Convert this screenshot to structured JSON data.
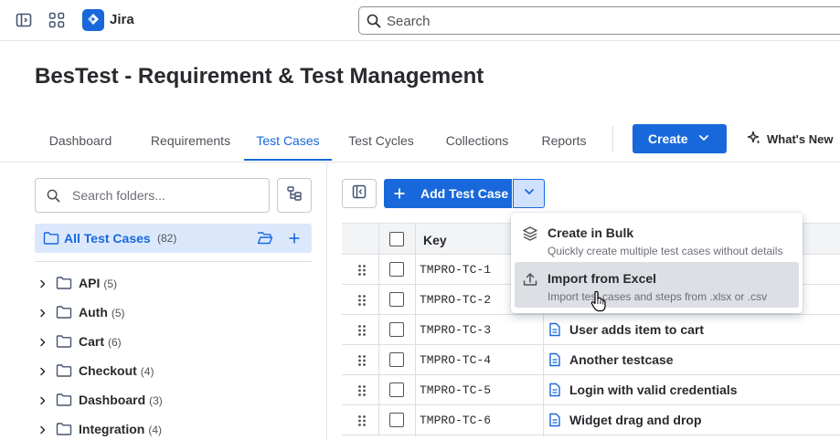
{
  "topbar": {
    "app_name": "Jira",
    "search_placeholder": "Search"
  },
  "page": {
    "title": "BesTest - Requirement & Test Management"
  },
  "tabs": [
    {
      "label": "Dashboard",
      "active": false
    },
    {
      "label": "Requirements",
      "active": false
    },
    {
      "label": "Test Cases",
      "active": true
    },
    {
      "label": "Test Cycles",
      "active": false
    },
    {
      "label": "Collections",
      "active": false
    },
    {
      "label": "Reports",
      "active": false
    }
  ],
  "actions": {
    "create_label": "Create",
    "whats_new_label": "What's New"
  },
  "folders_panel": {
    "search_placeholder": "Search folders...",
    "all_label": "All Test Cases",
    "all_count": "(82)",
    "folders": [
      {
        "name": "API",
        "count": "(5)"
      },
      {
        "name": "Auth",
        "count": "(5)"
      },
      {
        "name": "Cart",
        "count": "(6)"
      },
      {
        "name": "Checkout",
        "count": "(4)"
      },
      {
        "name": "Dashboard",
        "count": "(3)"
      },
      {
        "name": "Integration",
        "count": "(4)"
      }
    ]
  },
  "toolbar": {
    "add_test_case_label": "Add Test Case"
  },
  "table": {
    "key_header": "Key",
    "rows": [
      {
        "key": "TMPRO-TC-1",
        "summary": ""
      },
      {
        "key": "TMPRO-TC-2",
        "summary": ""
      },
      {
        "key": "TMPRO-TC-3",
        "summary": "User adds item to cart"
      },
      {
        "key": "TMPRO-TC-4",
        "summary": "Another testcase"
      },
      {
        "key": "TMPRO-TC-5",
        "summary": "Login with valid credentials"
      },
      {
        "key": "TMPRO-TC-6",
        "summary": "Widget drag and drop"
      }
    ]
  },
  "add_menu": {
    "items": [
      {
        "title": "Create in Bulk",
        "description": "Quickly create multiple test cases without details",
        "icon": "layers-icon"
      },
      {
        "title": "Import from Excel",
        "description": "Import test cases and steps from .xlsx or .csv",
        "icon": "upload-icon"
      }
    ]
  },
  "colors": {
    "brand_blue": "#1868db",
    "selected_bg": "#dbe8fc",
    "text": "#292a2e",
    "subtle_text": "#505258"
  }
}
